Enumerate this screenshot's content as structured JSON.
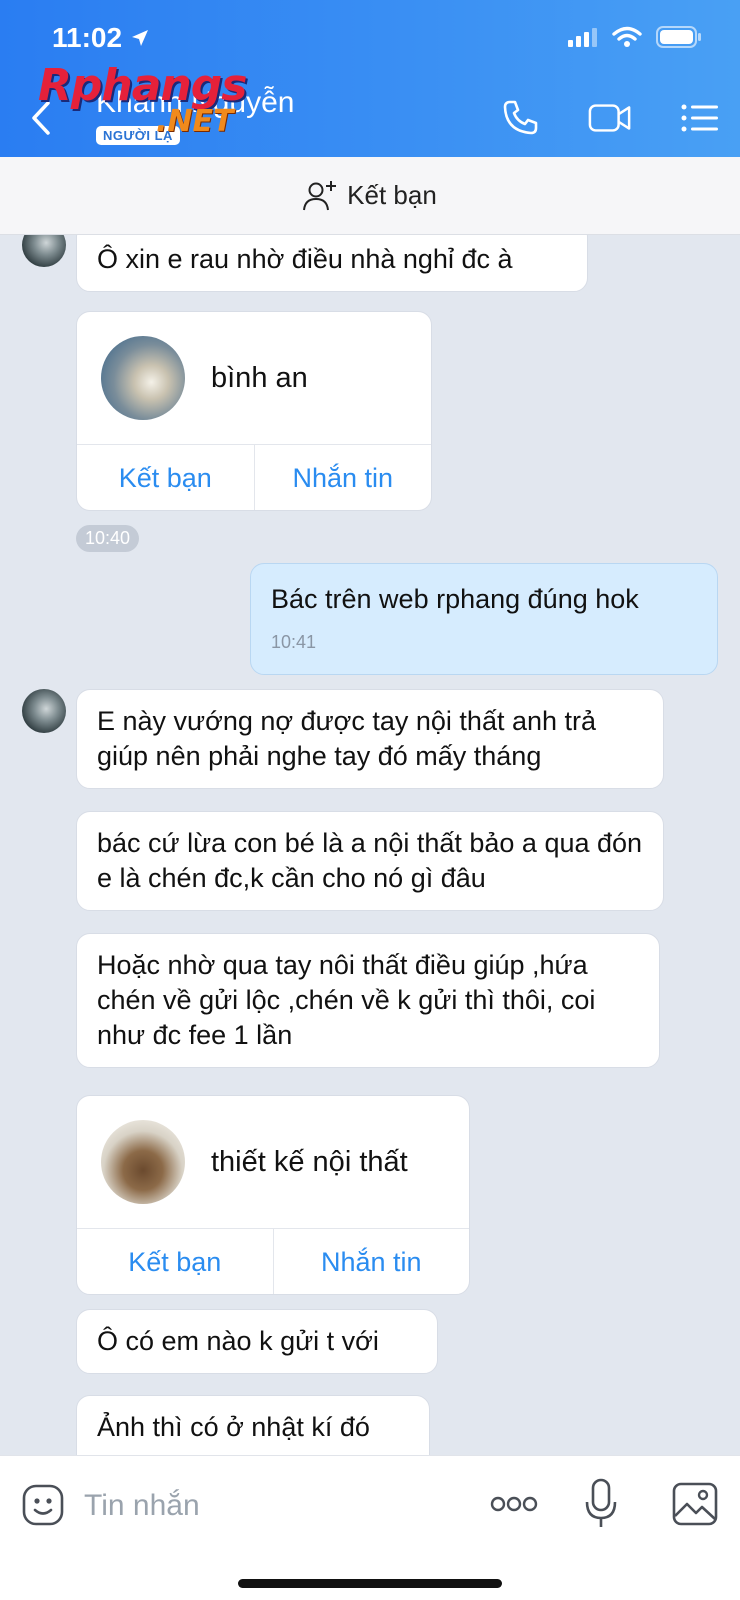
{
  "status": {
    "time": "11:02"
  },
  "header": {
    "title": "Khanh Nguyễn",
    "badge": "NGƯỜI LẠ"
  },
  "watermark": {
    "brand": "Rphangs",
    "tld": ".NET"
  },
  "add_friend": {
    "label": "Kết bạn"
  },
  "messages": {
    "m1": "Ô xin e rau nhờ điều nhà nghỉ đc à",
    "card1": {
      "name": "bình an",
      "add_label": "Kết bạn",
      "msg_label": "Nhắn tin"
    },
    "time1": "10:40",
    "me1": {
      "text": "Bác trên web rphang đúng hok",
      "time": "10:41"
    },
    "m2": "E này vướng nợ được tay nội thất anh trả giúp nên phải nghe tay đó mấy tháng",
    "m3": "bác cứ lừa con bé là a nội thất bảo a qua đón e là chén đc,k cần cho nó gì đâu",
    "m4": "Hoặc nhờ qua tay nôi thất điều giúp ,hứa chén về gửi lộc ,chén về k gửi thì thôi, coi như đc fee 1 lần",
    "card2": {
      "name": "thiết kế nội thất",
      "add_label": "Kết bạn",
      "msg_label": "Nhắn tin"
    },
    "m5": "Ô có em nào k gửi t với",
    "m6": "Ảnh thì có ở nhật kí đó"
  },
  "composer": {
    "placeholder": "Tin nhắn"
  },
  "colors": {
    "header": "#3a8ff3",
    "accent": "#2a8cf0",
    "my_bubble": "#d6ecfe",
    "chat_bg": "#e2e7ef"
  }
}
